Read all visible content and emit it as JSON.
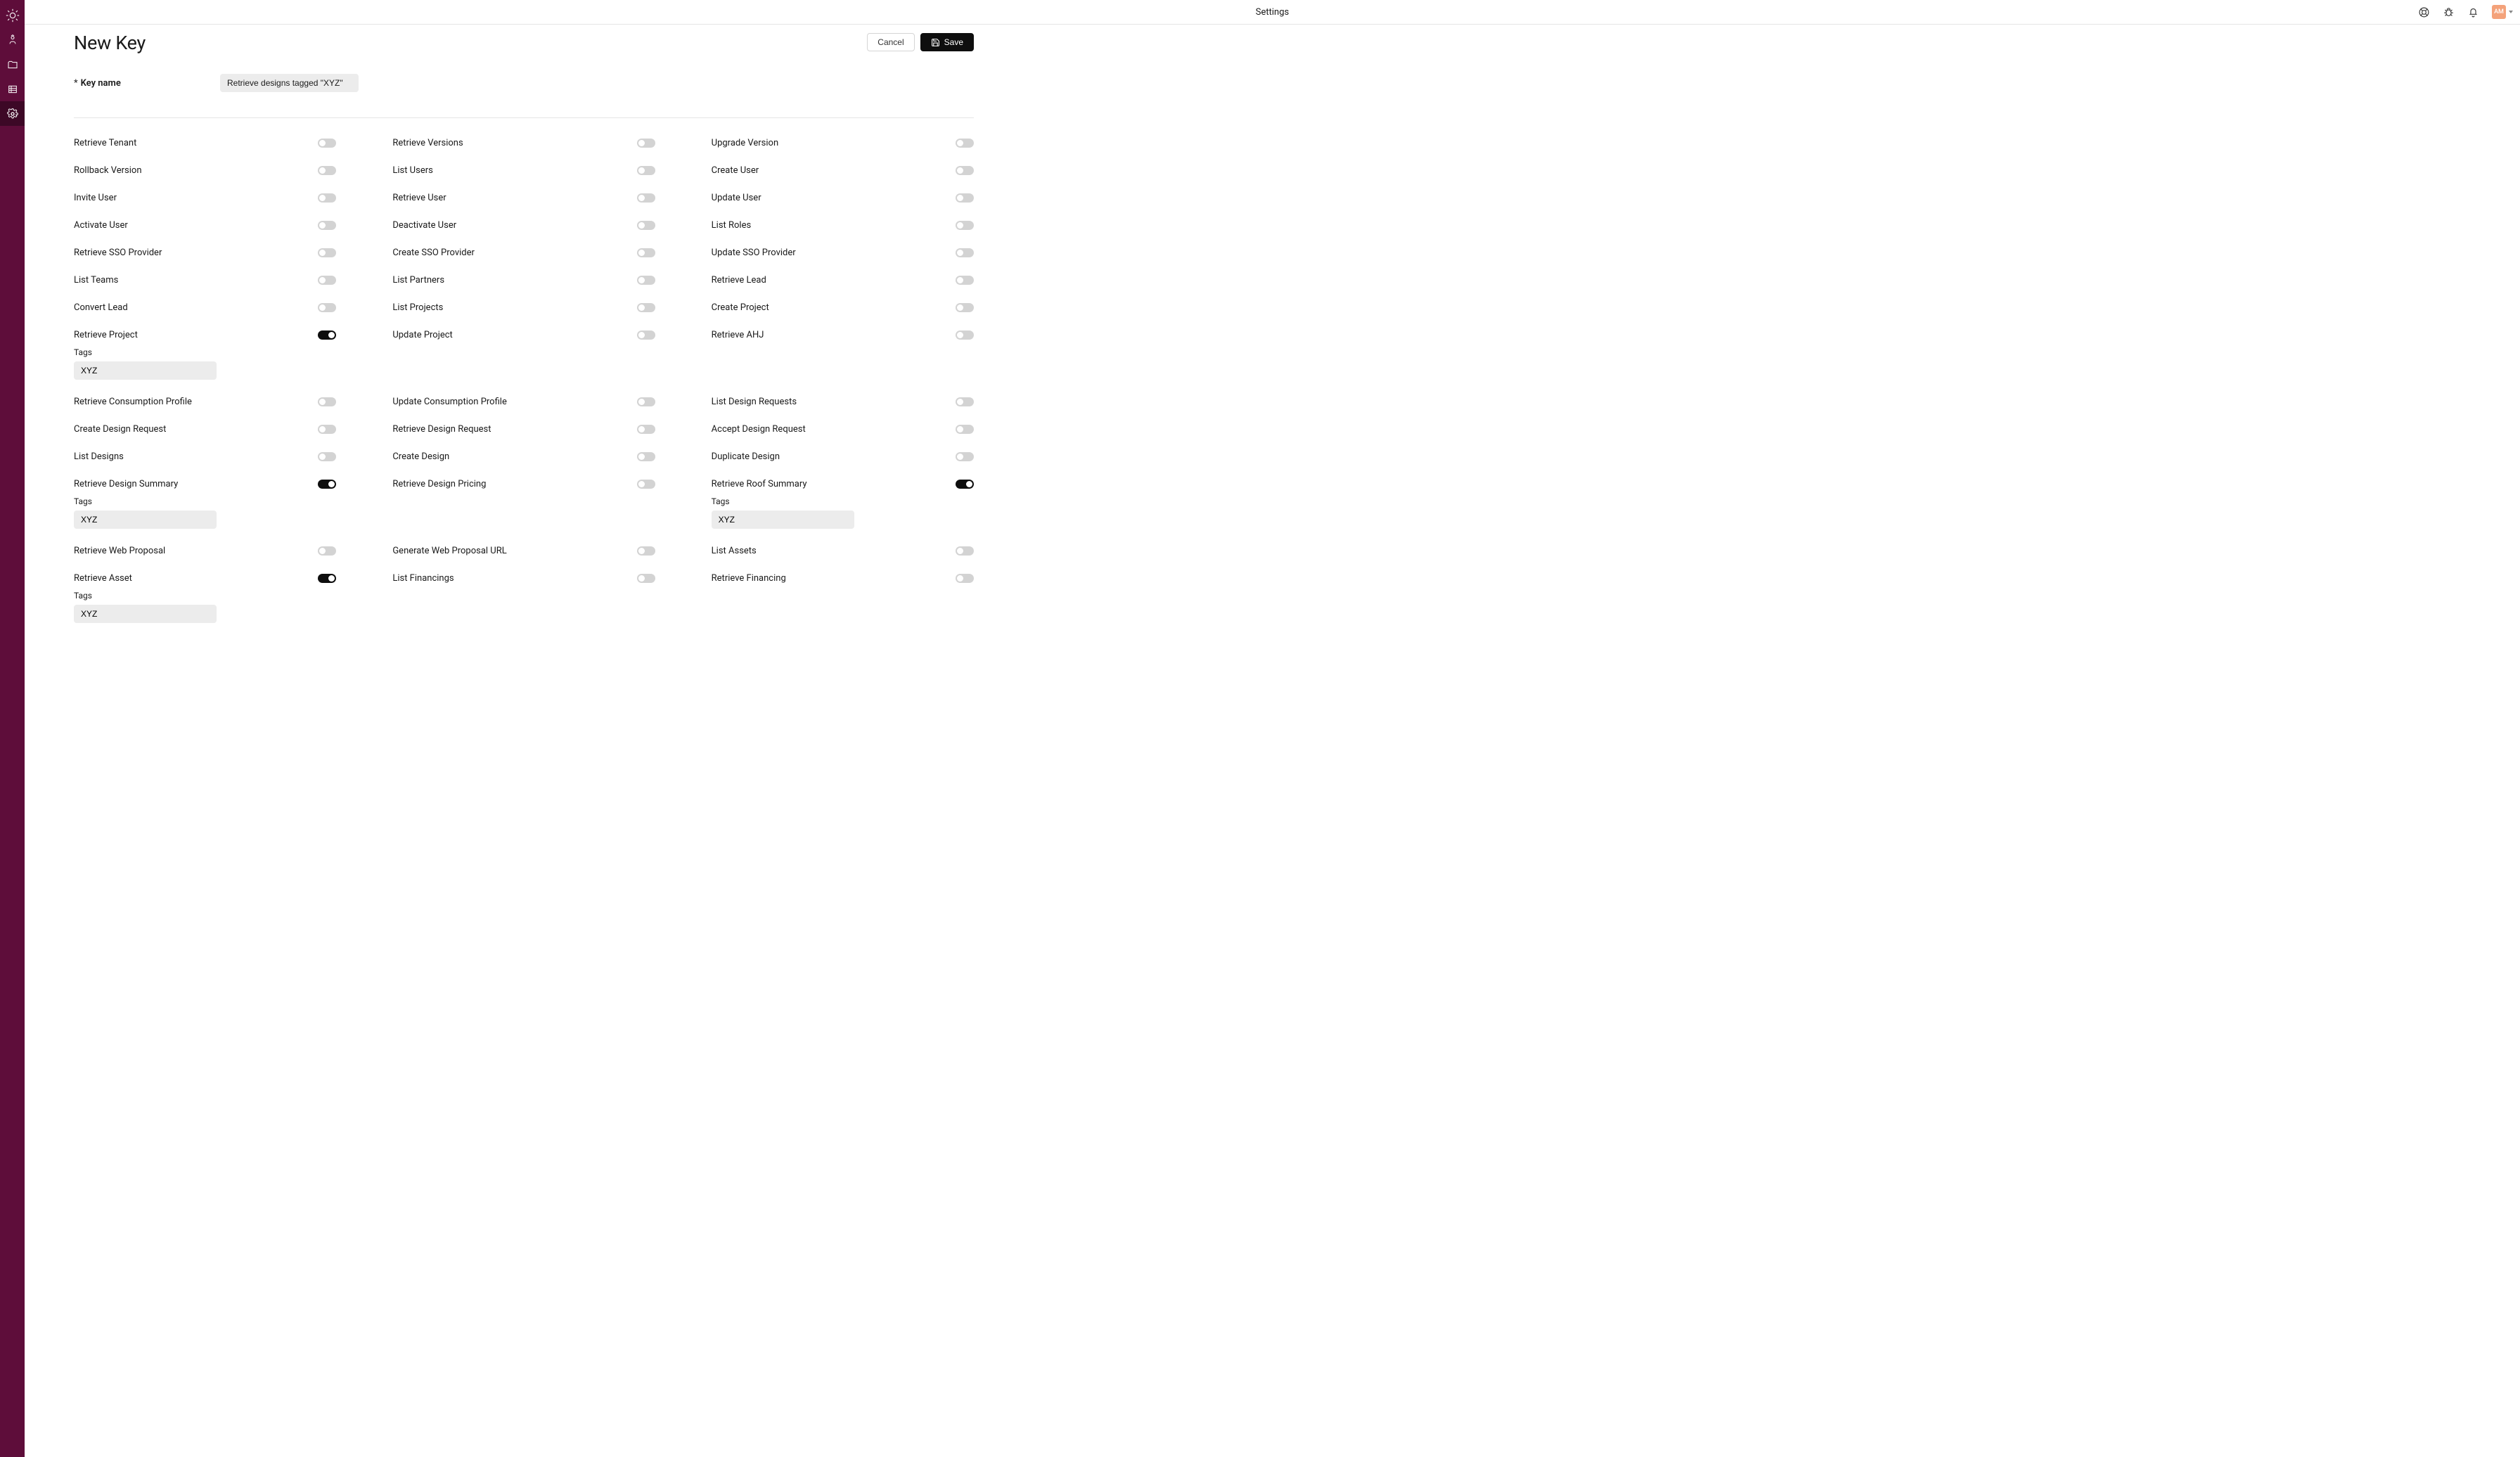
{
  "topbar": {
    "title": "Settings",
    "avatar": "AM"
  },
  "page": {
    "title": "New Key",
    "cancel_label": "Cancel",
    "save_label": "Save"
  },
  "keyname": {
    "label": "Key name",
    "required_mark": "*",
    "value": "Retrieve designs tagged \"XYZ\""
  },
  "tags_section_label": "Tags",
  "permissions": [
    {
      "label": "Retrieve Tenant",
      "on": false
    },
    {
      "label": "Retrieve Versions",
      "on": false
    },
    {
      "label": "Upgrade Version",
      "on": false
    },
    {
      "label": "Rollback Version",
      "on": false
    },
    {
      "label": "List Users",
      "on": false
    },
    {
      "label": "Create User",
      "on": false
    },
    {
      "label": "Invite User",
      "on": false
    },
    {
      "label": "Retrieve User",
      "on": false
    },
    {
      "label": "Update User",
      "on": false
    },
    {
      "label": "Activate User",
      "on": false
    },
    {
      "label": "Deactivate User",
      "on": false
    },
    {
      "label": "List Roles",
      "on": false
    },
    {
      "label": "Retrieve SSO Provider",
      "on": false
    },
    {
      "label": "Create SSO Provider",
      "on": false
    },
    {
      "label": "Update SSO Provider",
      "on": false
    },
    {
      "label": "List Teams",
      "on": false
    },
    {
      "label": "List Partners",
      "on": false
    },
    {
      "label": "Retrieve Lead",
      "on": false
    },
    {
      "label": "Convert Lead",
      "on": false
    },
    {
      "label": "List Projects",
      "on": false
    },
    {
      "label": "Create Project",
      "on": false
    },
    {
      "label": "Retrieve Project",
      "on": true,
      "tags": "XYZ"
    },
    {
      "label": "Update Project",
      "on": false
    },
    {
      "label": "Retrieve AHJ",
      "on": false
    },
    {
      "label": "Retrieve Consumption Profile",
      "on": false
    },
    {
      "label": "Update Consumption Profile",
      "on": false
    },
    {
      "label": "List Design Requests",
      "on": false
    },
    {
      "label": "Create Design Request",
      "on": false
    },
    {
      "label": "Retrieve Design Request",
      "on": false
    },
    {
      "label": "Accept Design Request",
      "on": false
    },
    {
      "label": "List Designs",
      "on": false
    },
    {
      "label": "Create Design",
      "on": false
    },
    {
      "label": "Duplicate Design",
      "on": false
    },
    {
      "label": "Retrieve Design Summary",
      "on": true,
      "tags": "XYZ"
    },
    {
      "label": "Retrieve Design Pricing",
      "on": false
    },
    {
      "label": "Retrieve Roof Summary",
      "on": true,
      "tags": "XYZ"
    },
    {
      "label": "Retrieve Web Proposal",
      "on": false
    },
    {
      "label": "Generate Web Proposal URL",
      "on": false
    },
    {
      "label": "List Assets",
      "on": false
    },
    {
      "label": "Retrieve Asset",
      "on": true,
      "tags": "XYZ"
    },
    {
      "label": "List Financings",
      "on": false
    },
    {
      "label": "Retrieve Financing",
      "on": false
    }
  ]
}
